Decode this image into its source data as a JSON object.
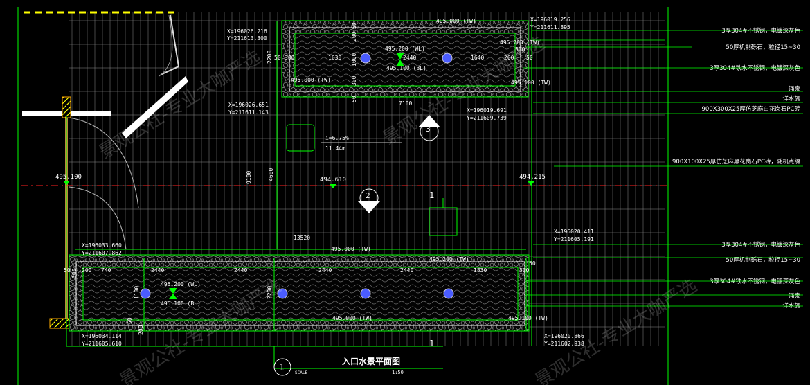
{
  "title": "入口水景平面图",
  "scale_word": "SCALE",
  "scale": "1:50",
  "sheet_no": "1",
  "section_mark": "1",
  "detail_refs": [
    "3",
    "2"
  ],
  "slope": {
    "pct": "i=6.75%",
    "len": "11.44m"
  },
  "levels": {
    "left": "495.100",
    "mid": "494.610",
    "right": "494.215",
    "top_tw_top": "495.000 (TW)",
    "top_tw_right": "495.200 (TW)",
    "top_wl": "495.200 (WL)",
    "top_bl": "495.100 (BL)",
    "top_tw_bottom": "495.000 (TW)",
    "top_tw_br": "495.100 (TW)",
    "bot_tw_top": "495.000 (TW)",
    "bot_tw_right": "495.200 (TW)",
    "bot_wl": "495.200 (WL)",
    "bot_bl": "495.100 (BL)",
    "bot_tw_bottom": "495.000 (TW)",
    "bot_tw_br": "495.100 (TW)"
  },
  "coords": {
    "a": [
      "X=196026.216",
      "Y=211613.300"
    ],
    "b": [
      "X=196019.256",
      "Y=211611.895"
    ],
    "c": [
      "X=196026.651",
      "Y=211611.143"
    ],
    "d": [
      "X=196019.691",
      "Y=211609.739"
    ],
    "e": [
      "X=196033.660",
      "Y=211607.862"
    ],
    "f": [
      "X=196020.411",
      "Y=211605.191"
    ],
    "g": [
      "X=196034.114",
      "Y=211605.610"
    ],
    "h": [
      "X=196020.866",
      "Y=211602.938"
    ]
  },
  "dims": {
    "top": [
      "50",
      "300",
      "1630",
      "2440",
      "1640",
      "200",
      "300",
      "50"
    ],
    "top_v": [
      "2200",
      "50",
      "200",
      "1000",
      "300",
      "50"
    ],
    "top_w": "7100",
    "mid_v": [
      "9100",
      "4600"
    ],
    "mid_h": "13520",
    "bot": [
      "50",
      "200",
      "740",
      "2440",
      "2440",
      "2440",
      "2440",
      "1830",
      "300",
      "50"
    ],
    "bot_v": [
      "300",
      "1100",
      "50",
      "200",
      "2200"
    ]
  },
  "notes_top": [
    "3厚304#不锈钢，电镀深灰色",
    "50厚机制砾石，粒径15~30",
    "3厚304#铁水不锈钢，电镀深灰色",
    "涌泉",
    "详水施",
    "900X300X25厚仿芝麻白花岗石PC砖"
  ],
  "note_mid": "900X100X25厚仿芝麻黑花岗石PC砖，随机点缀",
  "notes_bottom": [
    "3厚304#不锈钢，电镀深灰色",
    "50厚机制砾石，粒径15~30",
    "3厚304#铁水不锈钢，电镀深灰色",
    "涌泉",
    "详水施"
  ],
  "watermark": "景观公社-专业大咖严选",
  "colors": {
    "line": "#00ff00",
    "paving": "#8c8c8c",
    "red": "#ff2020",
    "yellow": "#ffff00",
    "fountain": "#4a5cff"
  }
}
